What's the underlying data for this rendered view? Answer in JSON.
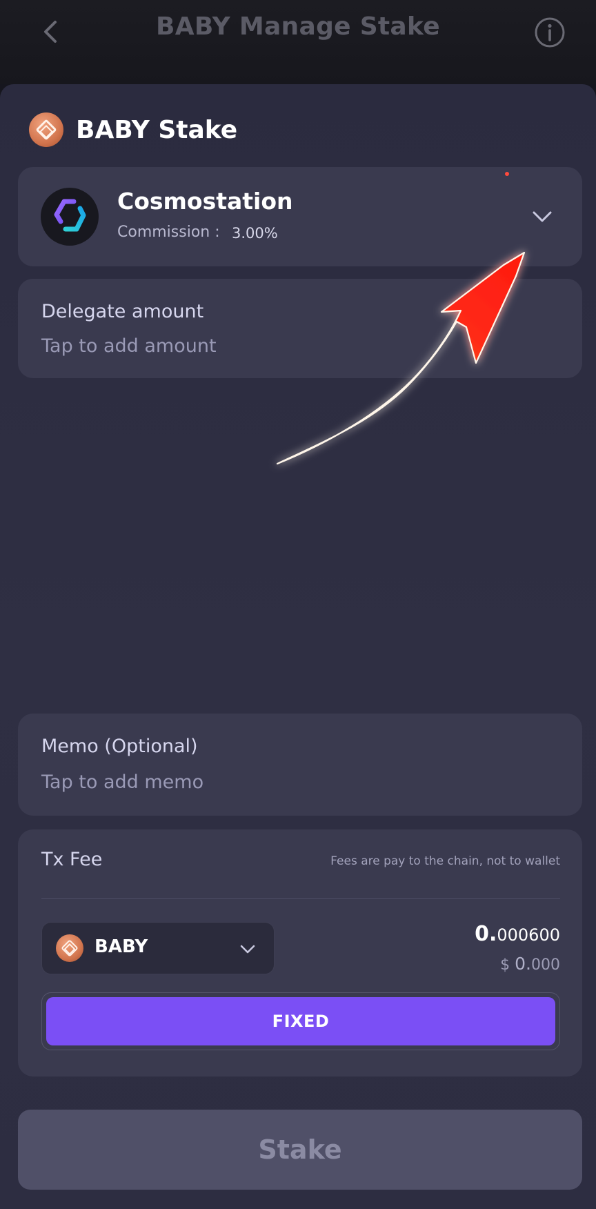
{
  "header": {
    "title": "BABY Manage Stake",
    "back_icon": "chevron-left-icon",
    "info_icon": "info-icon"
  },
  "sheet": {
    "title": "BABY Stake",
    "coin_icon": "baby-coin-icon"
  },
  "validator": {
    "name": "Cosmostation",
    "commission_label": "Commission :",
    "commission_value": "3.00%",
    "logo_icon": "cosmostation-logo-icon",
    "chevron_icon": "chevron-down-icon"
  },
  "delegate": {
    "label": "Delegate amount",
    "placeholder": "Tap to add amount"
  },
  "memo": {
    "label": "Memo (Optional)",
    "placeholder": "Tap to add memo"
  },
  "fee": {
    "label": "Tx Fee",
    "note": "Fees are pay to the chain, not to wallet",
    "token": "BABY",
    "amount_int": "0.",
    "amount_dec": "000600",
    "usd_prefix": "$ ",
    "usd_int": "0.",
    "usd_dec": "000",
    "fee_option": "FIXED"
  },
  "actions": {
    "stake_label": "Stake"
  },
  "colors": {
    "accent": "#7b4ff5",
    "background": "#2e2e42",
    "card": "#3a3a4f",
    "disabled_button": "#505068",
    "annotation_arrow": "#ff2a1a"
  }
}
